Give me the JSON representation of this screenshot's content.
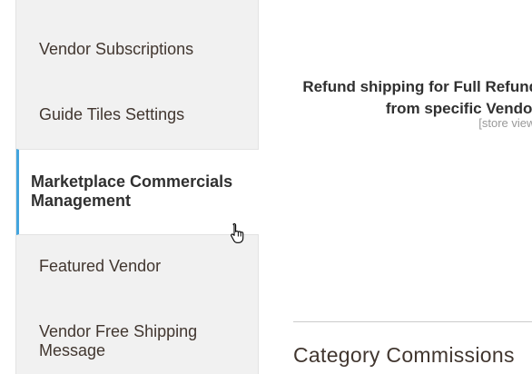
{
  "sidebar": {
    "items": [
      {
        "label": "Vendor Subscriptions",
        "active": false
      },
      {
        "label": "Guide Tiles Settings",
        "active": false
      },
      {
        "label": "Marketplace Commercials Management",
        "active": true
      },
      {
        "label": "Featured Vendor",
        "active": false
      },
      {
        "label": "Vendor Free Shipping Message",
        "active": false
      }
    ]
  },
  "main": {
    "field": {
      "label_line1": "Refund shipping for Full Refund",
      "label_line2": "from specific Vendor",
      "scope": "[store view]"
    },
    "section_title": "Category Commissions"
  },
  "colors": {
    "accent": "#43a5de",
    "sidebar_bg": "#f1f1f1",
    "text": "#41362f"
  },
  "icons": {
    "cursor": "hand-pointer-icon"
  }
}
